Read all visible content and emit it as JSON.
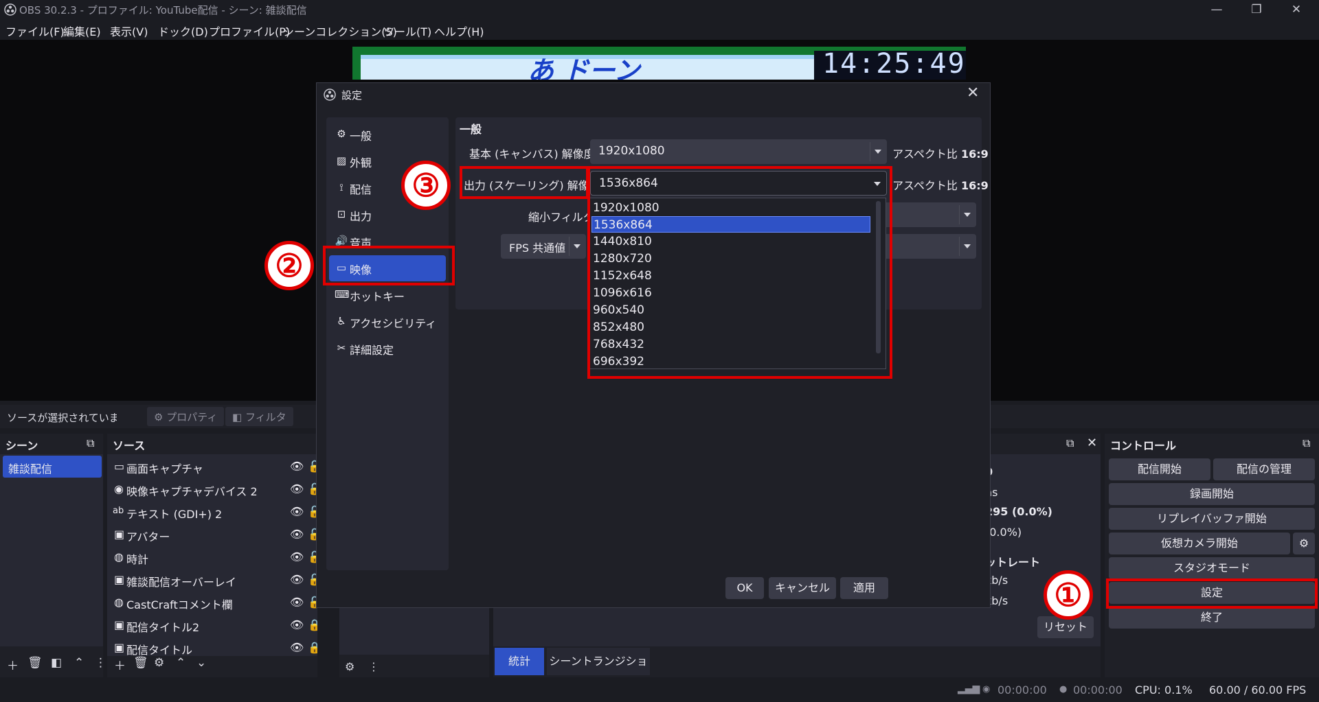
{
  "window": {
    "title": "OBS 30.2.3 - プロファイル: YouTube配信 - シーン: 雑談配信",
    "minimize": "—",
    "maximize": "❐",
    "close": "✕"
  },
  "menu": [
    "ファイル(F)",
    "編集(E)",
    "表示(V)",
    "ドック(D)",
    "プロファイル(P)",
    "シーンコレクション(S)",
    "ツール(T)",
    "ヘルプ(H)"
  ],
  "preview": {
    "clock": "14:25:49",
    "logo": "あ ドーン"
  },
  "source_bar": {
    "no_selection": "ソースが選択されていませ",
    "properties": "プロパティ",
    "filters": "フィルタ"
  },
  "scenes": {
    "title": "シーン",
    "items": [
      "雑談配信"
    ]
  },
  "sources": {
    "title": "ソース",
    "items": [
      {
        "icon": "monitor-icon",
        "label": "画面キャプチャ"
      },
      {
        "icon": "camera-icon",
        "label": "映像キャプチャデバイス 2"
      },
      {
        "icon": "text-icon",
        "label": "テキスト (GDI+) 2"
      },
      {
        "icon": "image-icon",
        "label": "アバター"
      },
      {
        "icon": "globe-icon",
        "label": "時計"
      },
      {
        "icon": "image-icon",
        "label": "雑談配信オーバーレイ"
      },
      {
        "icon": "globe-icon",
        "label": "CastCraftコメント欄"
      },
      {
        "icon": "image-icon",
        "label": "配信タイトル2"
      },
      {
        "icon": "image-icon",
        "label": "配信タイトル"
      }
    ]
  },
  "stats": {
    "values": [
      "0",
      "ns",
      "295 (0.0%)",
      "(0.0%)",
      "ットレート",
      "kb/s",
      "kb/s"
    ],
    "reset": "リセット",
    "tabs": [
      "統計",
      "シーントランジション"
    ]
  },
  "controls": {
    "title": "コントロール",
    "start_stream": "配信開始",
    "manage_stream": "配信の管理",
    "start_record": "録画開始",
    "replay_buffer": "リプレイバッファ開始",
    "virtual_cam": "仮想カメラ開始",
    "studio_mode": "スタジオモード",
    "settings": "設定",
    "exit": "終了"
  },
  "status": {
    "stream_time": "00:00:00",
    "record_time": "00:00:00",
    "cpu": "CPU: 0.1%",
    "fps": "60.00 / 60.00 FPS"
  },
  "settings_dialog": {
    "title": "設定",
    "nav": [
      {
        "icon": "gear-icon",
        "label": "一般"
      },
      {
        "icon": "appearance-icon",
        "label": "外観"
      },
      {
        "icon": "antenna-icon",
        "label": "配信"
      },
      {
        "icon": "output-icon",
        "label": "出力"
      },
      {
        "icon": "speaker-icon",
        "label": "音声"
      },
      {
        "icon": "monitor-icon",
        "label": "映像"
      },
      {
        "icon": "keyboard-icon",
        "label": "ホットキー"
      },
      {
        "icon": "accessibility-icon",
        "label": "アクセシビリティ"
      },
      {
        "icon": "tools-icon",
        "label": "詳細設定"
      }
    ],
    "active_nav": "映像",
    "section_title": "一般",
    "base_label": "基本 (キャンバス) 解像度",
    "base_value": "1920x1080",
    "output_label": "出力 (スケーリング) 解像度",
    "output_value": "1536x864",
    "aspect_label": "アスペクト比",
    "aspect_value": "16:9",
    "downscale_label": "縮小フィルタ",
    "fps_label": "FPS 共通値",
    "resolution_options": [
      "1920x1080",
      "1536x864",
      "1440x810",
      "1280x720",
      "1152x648",
      "1096x616",
      "960x540",
      "852x480",
      "768x432",
      "696x392"
    ],
    "selected_option": "1536x864",
    "ok": "OK",
    "cancel": "キャンセル",
    "apply": "適用"
  },
  "annotations": [
    "①",
    "②",
    "③"
  ],
  "colors": {
    "accent": "#2f52c6",
    "annotation_red": "#e00000"
  }
}
